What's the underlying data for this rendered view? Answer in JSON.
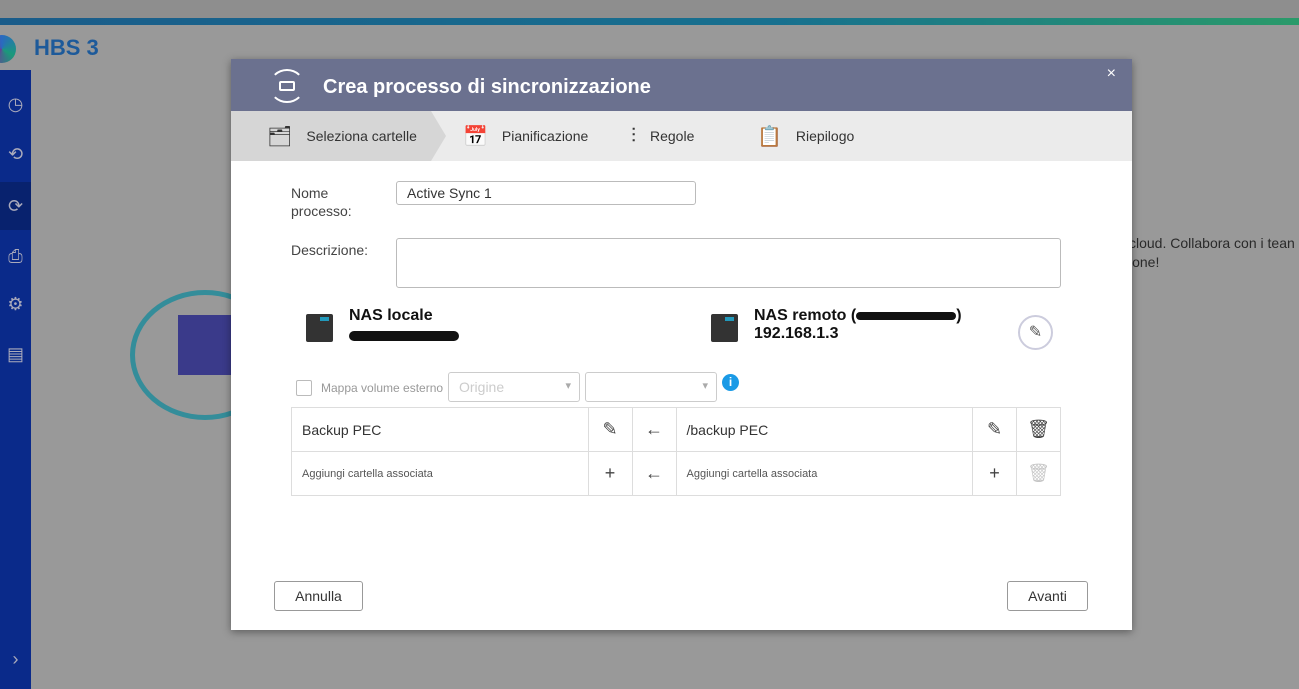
{
  "app": {
    "title": "HBS 3"
  },
  "background": {
    "text_line1": "i cloud. Collabora con i tean",
    "text_line2": "zione!"
  },
  "modal": {
    "title": "Crea processo di sincronizzazione",
    "close": "×",
    "steps": [
      {
        "label": "Seleziona cartelle"
      },
      {
        "label": "Pianificazione"
      },
      {
        "label": "Regole"
      },
      {
        "label": "Riepilogo"
      }
    ],
    "form": {
      "name_label": "Nome processo:",
      "name_value": "Active Sync 1",
      "desc_label": "Descrizione:",
      "desc_value": ""
    },
    "local": {
      "title": "NAS locale"
    },
    "remote": {
      "title": "NAS remoto (",
      "title_end": ")",
      "ip": "192.168.1.3"
    },
    "map_volume": {
      "label": "Mappa volume esterno",
      "origin_placeholder": "Origine",
      "checked": false
    },
    "rows": [
      {
        "local": "Backup PEC",
        "arrow": "←",
        "remote": "/backup PEC"
      },
      {
        "local": "Aggiungi cartella associata",
        "arrow": "←",
        "remote": "Aggiungi cartella associata"
      }
    ],
    "cancel": "Annulla",
    "next": "Avanti"
  }
}
